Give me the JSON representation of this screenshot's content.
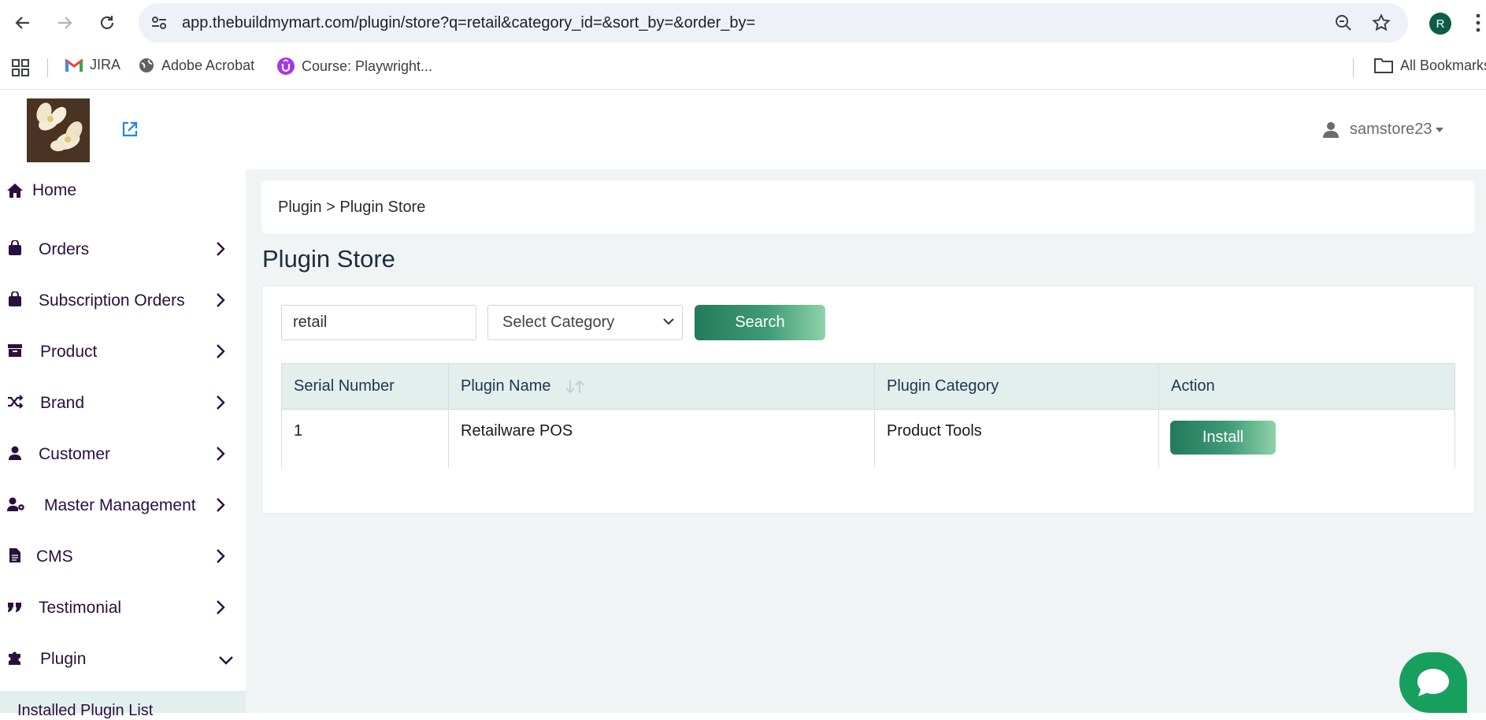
{
  "browser": {
    "url": "app.thebuildmymart.com/plugin/store?q=retail&category_id=&sort_by=&order_by=",
    "profile_initial": "R",
    "bookmarks": [
      {
        "label": "JIRA",
        "icon": "gmail-icon"
      },
      {
        "label": "Adobe Acrobat",
        "icon": "globe-icon"
      },
      {
        "label": "Course: Playwright...",
        "icon": "udemy-icon"
      }
    ],
    "all_bookmarks_label": "All Bookmarks"
  },
  "header": {
    "username": "samstore23"
  },
  "sidebar": {
    "items": [
      {
        "label": "Home",
        "icon": "home-icon"
      },
      {
        "label": "Orders",
        "icon": "shopping-bag-icon"
      },
      {
        "label": "Subscription Orders",
        "icon": "shopping-bag-icon"
      },
      {
        "label": "Product",
        "icon": "archive-box-icon"
      },
      {
        "label": "Brand",
        "icon": "shuffle-icon"
      },
      {
        "label": "Customer",
        "icon": "user-icon"
      },
      {
        "label": "Master Management",
        "icon": "user-gear-icon"
      },
      {
        "label": "CMS",
        "icon": "document-icon"
      },
      {
        "label": "Testimonial",
        "icon": "quote-icon"
      },
      {
        "label": "Plugin",
        "icon": "puzzle-icon"
      }
    ],
    "sub_item": "Installed Plugin List"
  },
  "main": {
    "breadcrumb": "Plugin > Plugin Store",
    "title": "Plugin Store",
    "search_value": "retail",
    "category_select": "Select Category",
    "search_button": "Search",
    "table": {
      "headers": [
        "Serial Number",
        "Plugin Name",
        "Plugin Category",
        "Action"
      ],
      "rows": [
        {
          "serial": "1",
          "name": "Retailware POS",
          "category": "Product Tools",
          "action": "Install"
        }
      ]
    }
  },
  "colors": {
    "accent": "#247a5c",
    "sidebar_text": "#2a0f3f",
    "main_bg": "#f0f4f4",
    "table_header_bg": "#e3efec"
  }
}
